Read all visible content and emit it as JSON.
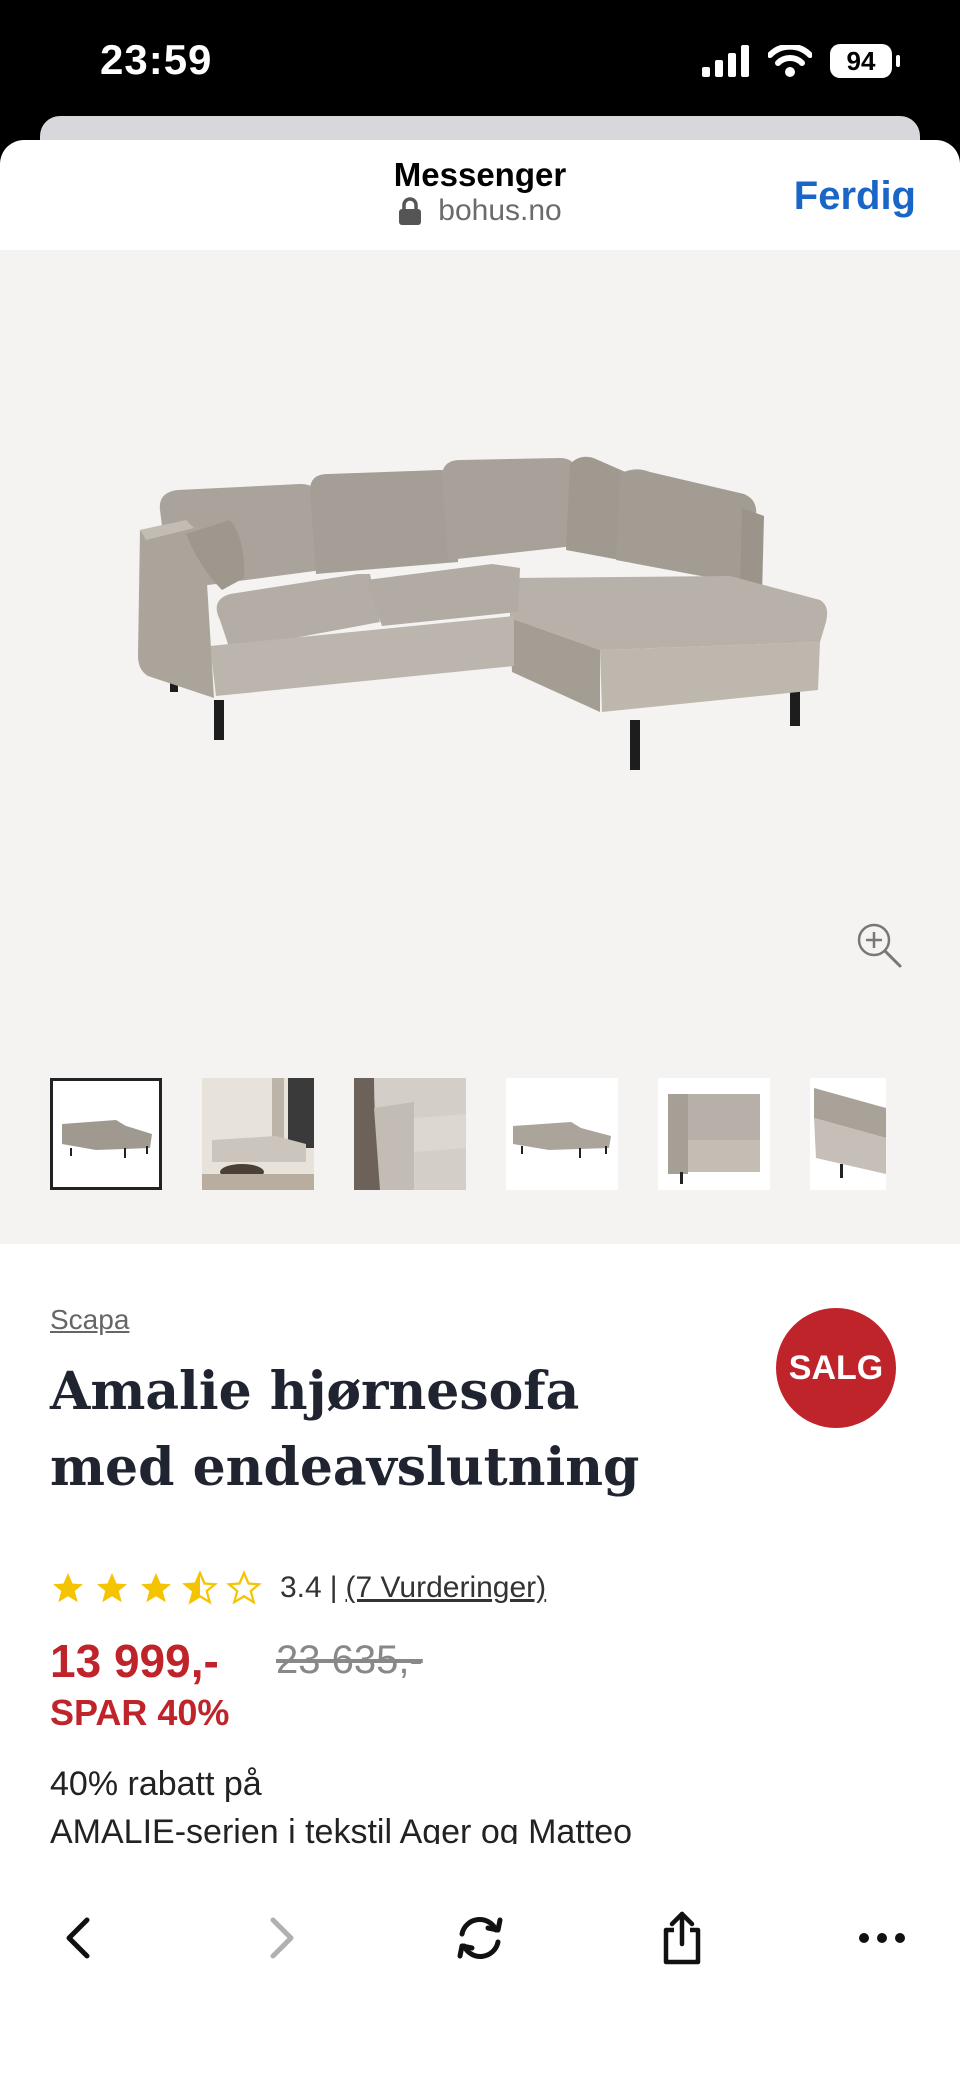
{
  "status_bar": {
    "time": "23:59",
    "battery": "94"
  },
  "browser": {
    "title": "Messenger",
    "domain": "bohus.no",
    "done_label": "Ferdig"
  },
  "gallery": {
    "thumbnails": [
      "sofa-front",
      "sofa-room",
      "sofa-arm-closeup",
      "sofa-front-small",
      "sofa-seat-closeup",
      "sofa-chaise-closeup"
    ],
    "selected_index": 0
  },
  "product": {
    "brand": "Scapa",
    "title": "Amalie hjørnesofa med endeavslutning",
    "badge": "SALG",
    "rating_value": "3.4",
    "rating_separator": "|",
    "rating_stars": 3.5,
    "reviews_link": "(7 Vurderinger)",
    "price": "13 999,-",
    "old_price": "23 635,-",
    "savings": "SPAR 40%",
    "campaign_line1": "40% rabatt på",
    "campaign_line2": "AMALIE-serien i tekstil Ager og Matteo"
  },
  "colors": {
    "accent": "#1a66c7",
    "sale": "#c0242b",
    "star": "#f5c400"
  }
}
